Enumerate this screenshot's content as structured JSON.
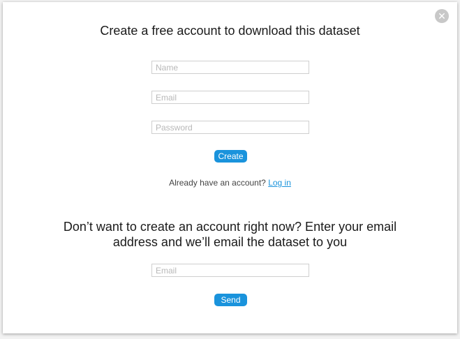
{
  "modal": {
    "close_glyph": "✕",
    "signup": {
      "title": "Create a free account to download this dataset",
      "name_placeholder": "Name",
      "email_placeholder": "Email",
      "password_placeholder": "Password",
      "create_label": "Create",
      "login_prompt": "Already have an account?",
      "login_link": "Log in"
    },
    "email_only": {
      "title_line1": "Don’t want to create an account right now? Enter your email",
      "title_line2": "address and we’ll email the dataset to you",
      "email_placeholder": "Email",
      "send_label": "Send"
    }
  },
  "colors": {
    "accent": "#1a93dc",
    "close_bg": "#c8c8c8",
    "field_border": "#cfcfcf"
  },
  "icons": {
    "close": "close-icon"
  }
}
